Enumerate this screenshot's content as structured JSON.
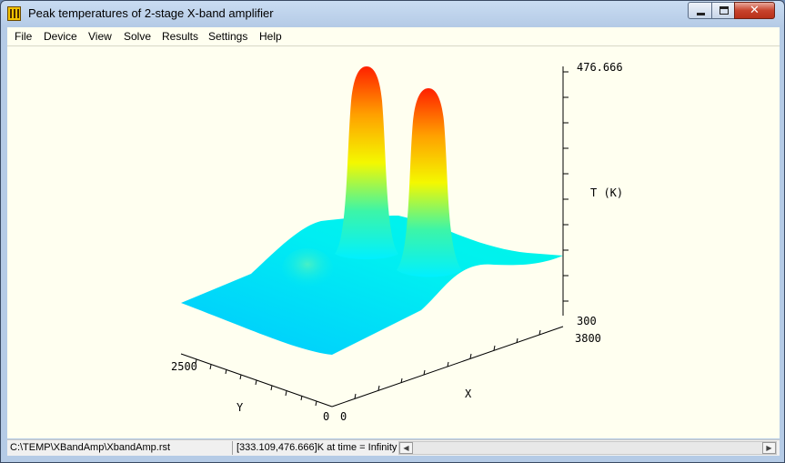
{
  "window": {
    "title": "Peak temperatures of 2-stage X-band amplifier"
  },
  "menu": [
    "File",
    "Device",
    "View",
    "Solve",
    "Results",
    "Settings",
    "Help"
  ],
  "plot": {
    "t_max_label": "476.666",
    "t_min_label": "300",
    "t_axis_label": "T (K)",
    "x_max_label": "3800",
    "x_min_label": "0",
    "x_axis_label": "X",
    "y_max_label": "2500",
    "y_min_label": "0",
    "y_axis_label": "Y"
  },
  "status": {
    "path": "C:\\TEMP\\XBandAmp\\XbandAmp.rst",
    "value": "[333.109,476.666]K at time = Infinity"
  },
  "icons": {
    "minimize": "minimize-icon",
    "maximize": "maximize-icon",
    "close": "close-icon",
    "app": "app-icon"
  }
}
